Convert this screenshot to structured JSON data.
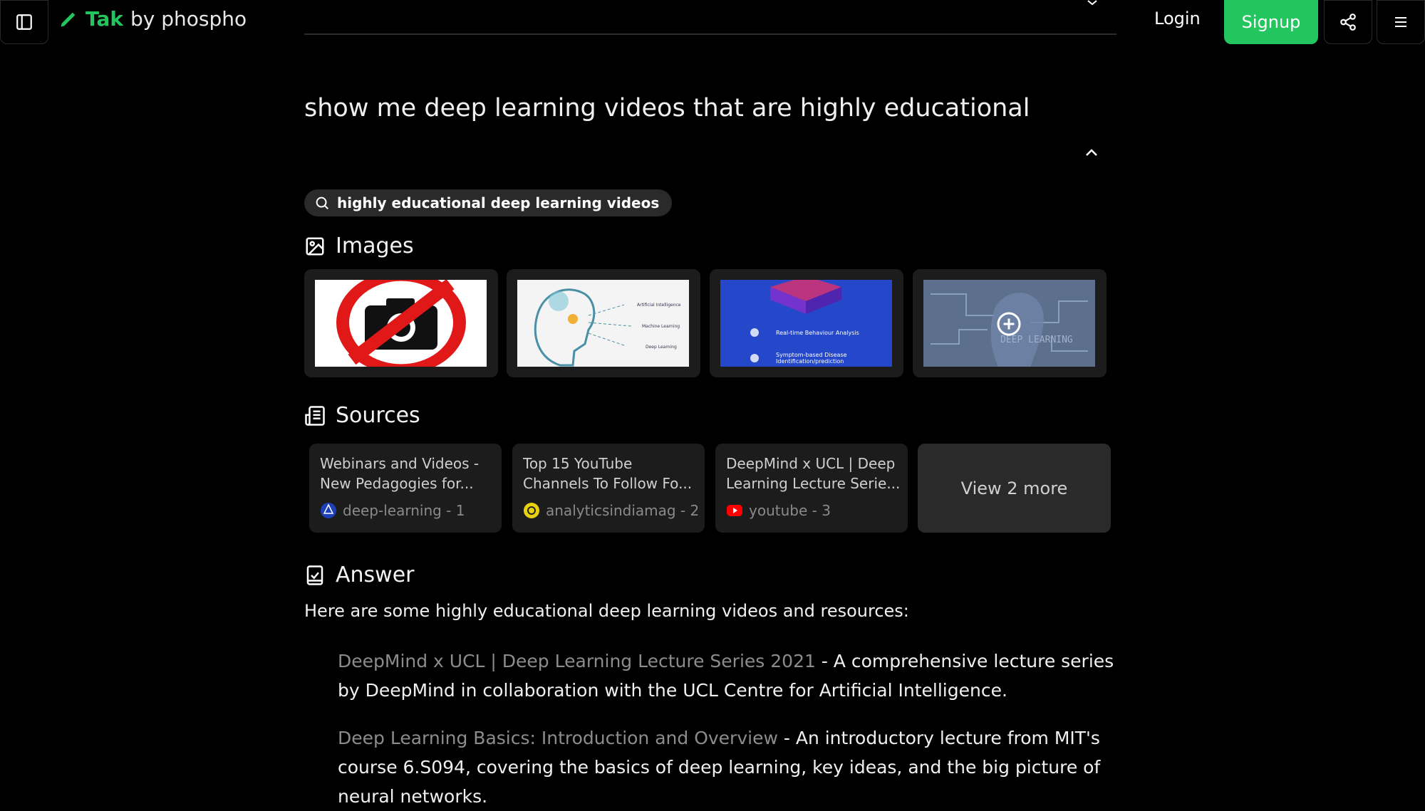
{
  "header": {
    "brand_name": "Tak",
    "brand_by": "by phospho",
    "login_label": "Login",
    "signup_label": "Signup",
    "accent_color": "#22c55e"
  },
  "query": "show me deep learning videos that are highly educational",
  "search_pill": "highly educational deep learning videos",
  "images": {
    "heading": "Images",
    "thumb2_labels": [
      "Artificial Intelligence",
      "Machine Learning",
      "Deep Learning"
    ],
    "thumb3_labels": [
      "Real-time Behaviour Analysis",
      "Symptom-based Disease",
      "Identification/prediction"
    ],
    "thumb4_label": "DEEP LEARNING"
  },
  "sources": {
    "heading": "Sources",
    "items": [
      {
        "title_line1": "Webinars and Videos -",
        "title_line2": "New Pedagogies for...",
        "site": "deep-learning - 1"
      },
      {
        "title_line1": "Top 15 YouTube",
        "title_line2": "Channels To Follow Fo...",
        "site": "analyticsindiamag - 2"
      },
      {
        "title_line1": "DeepMind x UCL | Deep",
        "title_line2": "Learning Lecture Serie...",
        "site": "youtube - 3"
      }
    ],
    "view_more": "View 2 more"
  },
  "answer": {
    "heading": "Answer",
    "intro": "Here are some highly educational deep learning videos and resources:",
    "items": [
      {
        "link": "DeepMind x UCL | Deep Learning Lecture Series 2021",
        "text": " - A comprehensive lecture series by DeepMind in collaboration with the UCL Centre for Artificial Intelligence."
      },
      {
        "link": "Deep Learning Basics: Introduction and Overview",
        "text": " - An introductory lecture from MIT's course 6.S094, covering the basics of deep learning, key ideas, and the big picture of neural networks."
      }
    ]
  }
}
